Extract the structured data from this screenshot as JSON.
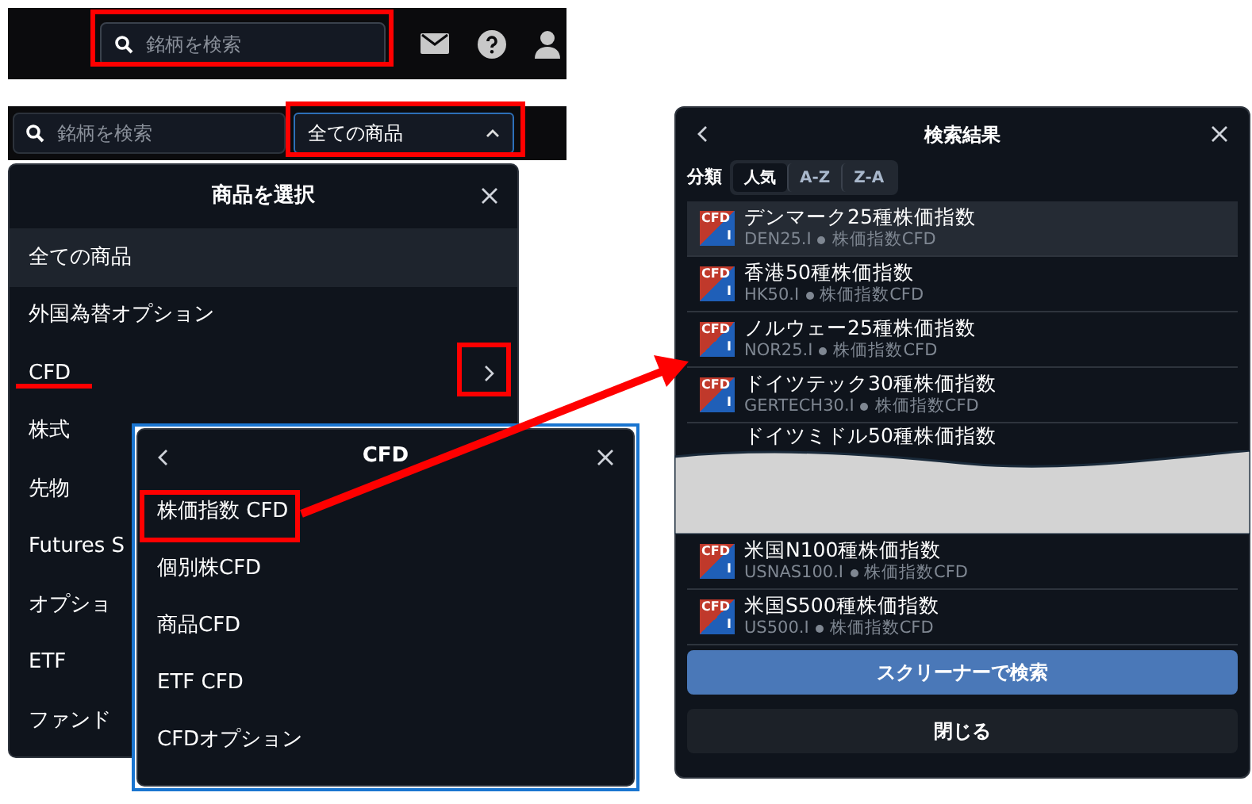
{
  "top_bar": {
    "search": {
      "placeholder": "銘柄を検索"
    }
  },
  "filter_bar": {
    "search": {
      "placeholder": "銘柄を検索"
    },
    "dropdown": {
      "value": "全ての商品",
      "expanded": true
    }
  },
  "product_panel": {
    "title": "商品を選択",
    "items": [
      {
        "label": "全ての商品",
        "selected": true,
        "has_children": false
      },
      {
        "label": "外国為替オプション",
        "selected": false,
        "has_children": false
      },
      {
        "label": "CFD",
        "selected": false,
        "has_children": true
      },
      {
        "label": "株式",
        "selected": false,
        "has_children": false
      },
      {
        "label": "先物",
        "selected": false,
        "has_children": false
      },
      {
        "label": "Futures S",
        "selected": false,
        "has_children": false
      },
      {
        "label": "オプショ",
        "selected": false,
        "has_children": false
      },
      {
        "label": "ETF",
        "selected": false,
        "has_children": false
      },
      {
        "label": "ファンド",
        "selected": false,
        "has_children": false
      }
    ]
  },
  "cfd_panel": {
    "title": "CFD",
    "items": [
      {
        "label": "株価指数 CFD"
      },
      {
        "label": "個別株CFD"
      },
      {
        "label": "商品CFD"
      },
      {
        "label": "ETF CFD"
      },
      {
        "label": "CFDオプション"
      }
    ]
  },
  "results_panel": {
    "title": "検索結果",
    "sort_label": "分類",
    "sort_tabs": [
      {
        "label": "人気",
        "selected": true
      },
      {
        "label": "A-Z",
        "selected": false
      },
      {
        "label": "Z-A",
        "selected": false
      }
    ],
    "rows": [
      {
        "badge": "CFD",
        "badge_sub": "I",
        "name": "デンマーク25種株価指数",
        "code": "DEN25.I",
        "type": "株価指数CFD",
        "selected": true
      },
      {
        "badge": "CFD",
        "badge_sub": "I",
        "name": "香港50種株価指数",
        "code": "HK50.I",
        "type": "株価指数CFD",
        "selected": false
      },
      {
        "badge": "CFD",
        "badge_sub": "I",
        "name": "ノルウェー25種株価指数",
        "code": "NOR25.I",
        "type": "株価指数CFD",
        "selected": false
      },
      {
        "badge": "CFD",
        "badge_sub": "I",
        "name": "ドイツテック30種株価指数",
        "code": "GERTECH30.I",
        "type": "株価指数CFD",
        "selected": false
      },
      {
        "name": "ドイツミドル50種株価指数",
        "selected": false
      },
      {
        "badge": "CFD",
        "badge_sub": "I",
        "name": "米国N100種株価指数",
        "code": "USNAS100.I",
        "type": "株価指数CFD",
        "selected": false
      },
      {
        "badge": "CFD",
        "badge_sub": "I",
        "name": "米国S500種株価指数",
        "code": "US500.I",
        "type": "株価指数CFD",
        "selected": false
      }
    ],
    "buttons": [
      {
        "label": "スクリーナーで検索",
        "kind": "primary"
      },
      {
        "label": "閉じる",
        "kind": "secondary"
      }
    ]
  }
}
